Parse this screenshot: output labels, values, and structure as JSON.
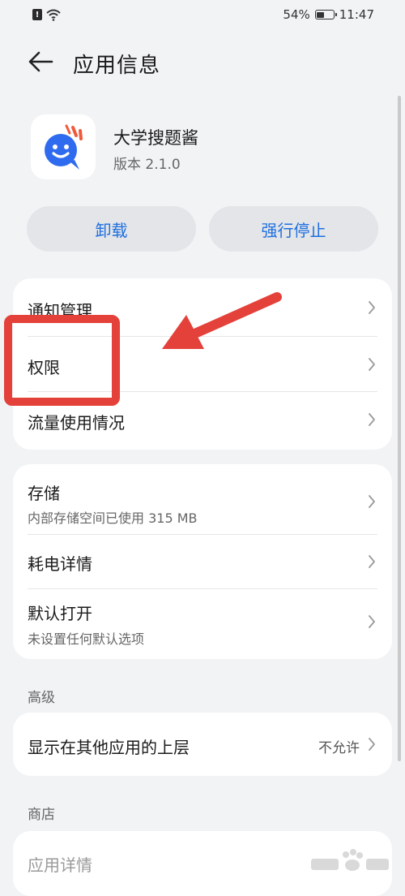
{
  "status_bar": {
    "battery": "54%",
    "battery_level": 0.54,
    "time": "11:47"
  },
  "header": {
    "title": "应用信息"
  },
  "app": {
    "name": "大学搜题酱",
    "version": "版本 2.1.0"
  },
  "actions": {
    "uninstall": "卸载",
    "force_stop": "强行停止"
  },
  "group1": {
    "notifications": "通知管理",
    "permissions": "权限",
    "data_usage": "流量使用情况"
  },
  "group2": {
    "storage": "存储",
    "storage_sub": "内部存储空间已使用 315 MB",
    "battery_details": "耗电详情",
    "default_open": "默认打开",
    "default_open_sub": "未设置任何默认选项"
  },
  "advanced": {
    "label": "高级",
    "overlay": "显示在其他应用的上层",
    "overlay_value": "不允许"
  },
  "store": {
    "label": "商店",
    "app_details": "应用详情"
  },
  "colors": {
    "accent": "#1f6fe0",
    "highlight": "#e4413a",
    "app_icon": "#2f6bef"
  }
}
